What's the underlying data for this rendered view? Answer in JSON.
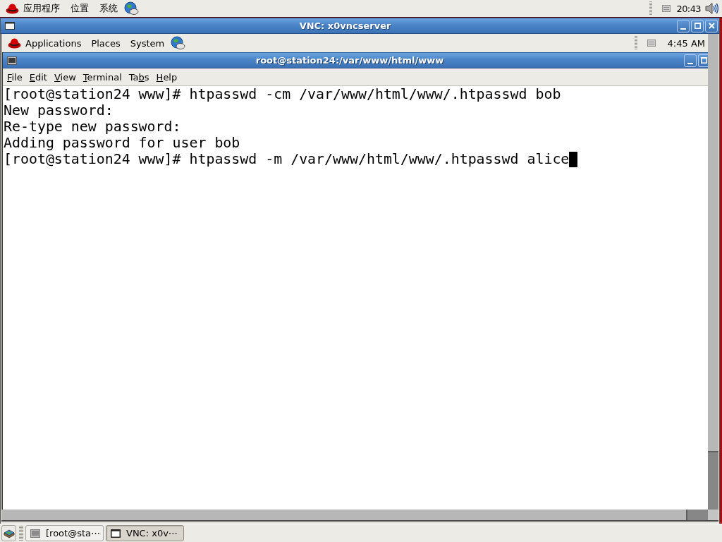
{
  "top_panel": {
    "menus": [
      "应用程序",
      "位置",
      "系统"
    ],
    "clock": "20:43"
  },
  "vnc_window": {
    "title": "VNC: x0vncserver",
    "remote_panel": {
      "menus": [
        "Applications",
        "Places",
        "System"
      ],
      "clock": "4:45 AM"
    },
    "terminal": {
      "title": "root@station24:/var/www/html/www",
      "menu": [
        {
          "key": "F",
          "after": "ile"
        },
        {
          "key": "E",
          "after": "dit"
        },
        {
          "key": "V",
          "after": "iew"
        },
        {
          "key": "T",
          "after": "erminal"
        },
        {
          "before": "Ta",
          "key": "b",
          "after": "s"
        },
        {
          "key": "H",
          "after": "elp"
        }
      ],
      "lines": [
        "[root@station24 www]# htpasswd -cm /var/www/html/www/.htpasswd bob",
        "New password:",
        "Re-type new password:",
        "Adding password for user bob",
        "[root@station24 www]# htpasswd -m /var/www/html/www/.htpasswd alice"
      ],
      "cursor": true
    }
  },
  "taskbar": {
    "tasks": [
      {
        "kind": "terminal",
        "label": "[root@sta⋯",
        "selected": false
      },
      {
        "kind": "window",
        "label": "VNC: x0v⋯",
        "selected": true
      }
    ]
  }
}
